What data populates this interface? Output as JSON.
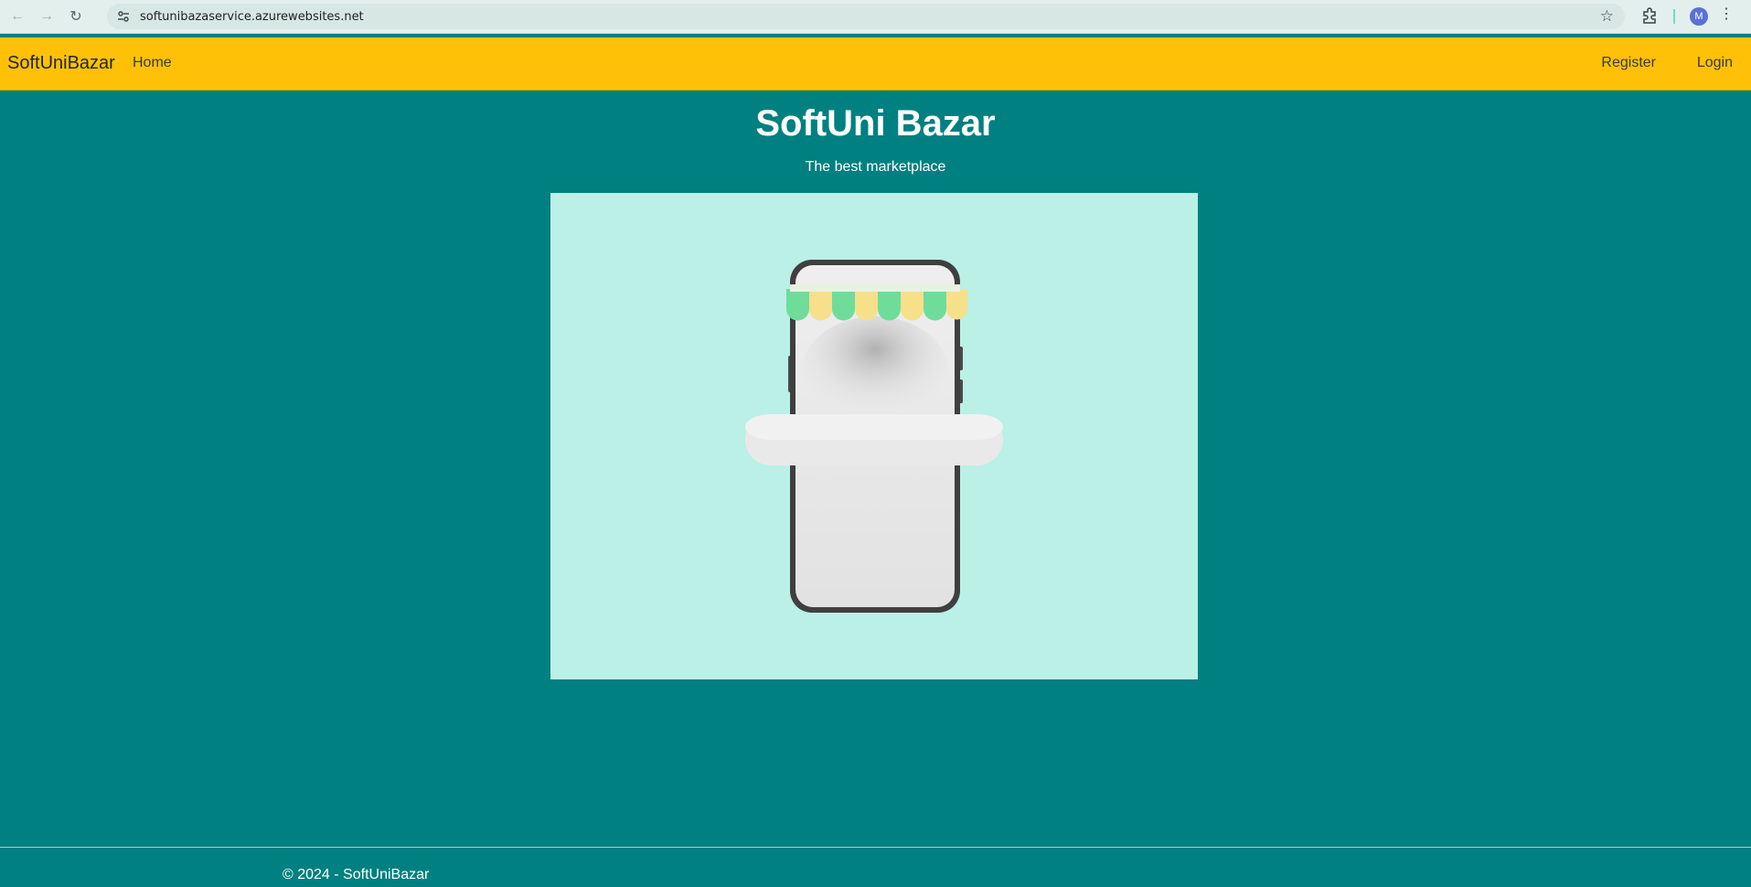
{
  "browser": {
    "url": "softunibazaservice.azurewebsites.net",
    "profile_initial": "M"
  },
  "navbar": {
    "brand": "SoftUniBazar",
    "home": "Home",
    "register": "Register",
    "login": "Login",
    "color": "#ffc107"
  },
  "main": {
    "title": "SoftUni Bazar",
    "subtitle": "The best marketplace",
    "hero_image": "phone-shop-illustration",
    "background_color": "#008080",
    "hero_background": "#baf0e6"
  },
  "footer": {
    "copyright": "© 2024 - SoftUniBazar"
  }
}
